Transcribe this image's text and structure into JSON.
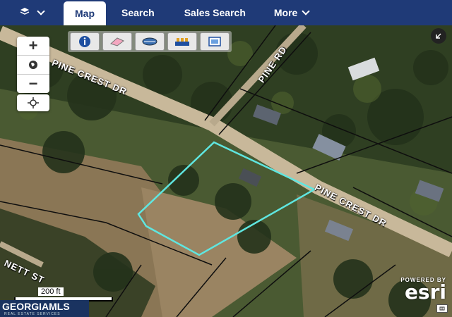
{
  "nav": {
    "menu_icon": "layers-icon",
    "tabs": [
      {
        "label": "Map",
        "active": true
      },
      {
        "label": "Search",
        "active": false
      },
      {
        "label": "Sales Search",
        "active": false
      },
      {
        "label": "More",
        "active": false
      }
    ]
  },
  "map": {
    "road_labels": {
      "pine_crest_upper": "PINE CREST DR",
      "pine_crest_lower": "PINE CREST DR",
      "pine_rd": "PINE RD",
      "nett_st": "NETT ST"
    },
    "zoom": {
      "zoom_in": "+",
      "globe_icon": "globe-icon",
      "zoom_out": "−"
    },
    "locate_icon": "crosshair-icon",
    "tools": [
      "info-icon",
      "eraser-icon",
      "measure-icon",
      "legend-icon",
      "print-icon"
    ],
    "overview_icon": "arrow-icon",
    "scale": "200 ft",
    "logo_main": "GEORGIAMLS",
    "logo_sub": "REAL ESTATE SERVICES",
    "esri_powered": "POWERED BY",
    "esri_word": "esri",
    "highlight_color": "#5fe6e0",
    "nav_color": "#1f3a77"
  }
}
